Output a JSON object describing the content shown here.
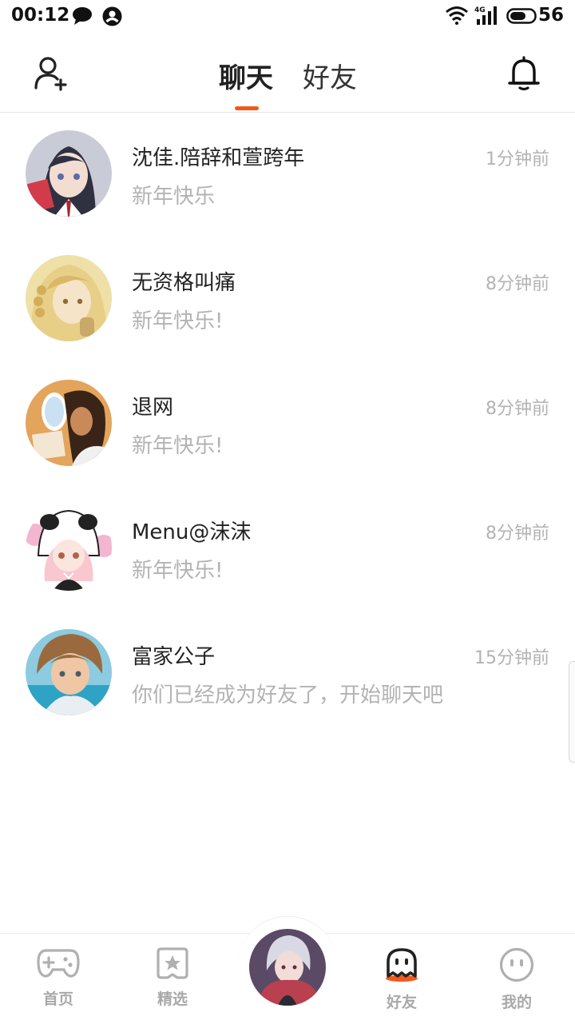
{
  "status_bar": {
    "time": "00:12",
    "battery": "56",
    "network": "4G"
  },
  "header": {
    "tabs": [
      {
        "label": "聊天",
        "active": true
      },
      {
        "label": "好友",
        "active": false
      }
    ]
  },
  "chats": [
    {
      "name": "沈佳.陪辞和萱跨年",
      "message": "新年快乐",
      "time": "1分钟前"
    },
    {
      "name": "无资格叫痛",
      "message": "新年快乐!",
      "time": "8分钟前"
    },
    {
      "name": "退网",
      "message": "新年快乐!",
      "time": "8分钟前"
    },
    {
      "name": "Menu@沫沫",
      "message": "新年快乐!",
      "time": "8分钟前"
    },
    {
      "name": "富家公子",
      "message": "你们已经成为好友了，开始聊天吧",
      "time": "15分钟前"
    }
  ],
  "bottom_nav": [
    {
      "label": "首页",
      "icon": "gamepad-icon",
      "active": false
    },
    {
      "label": "精选",
      "icon": "star-box-icon",
      "active": false
    },
    {
      "label": "好友",
      "icon": "ghost-icon",
      "active": true
    },
    {
      "label": "我的",
      "icon": "smiley-icon",
      "active": false
    }
  ],
  "colors": {
    "accent": "#f05a1e",
    "text_primary": "#222222",
    "text_secondary": "#b3b3b3"
  }
}
